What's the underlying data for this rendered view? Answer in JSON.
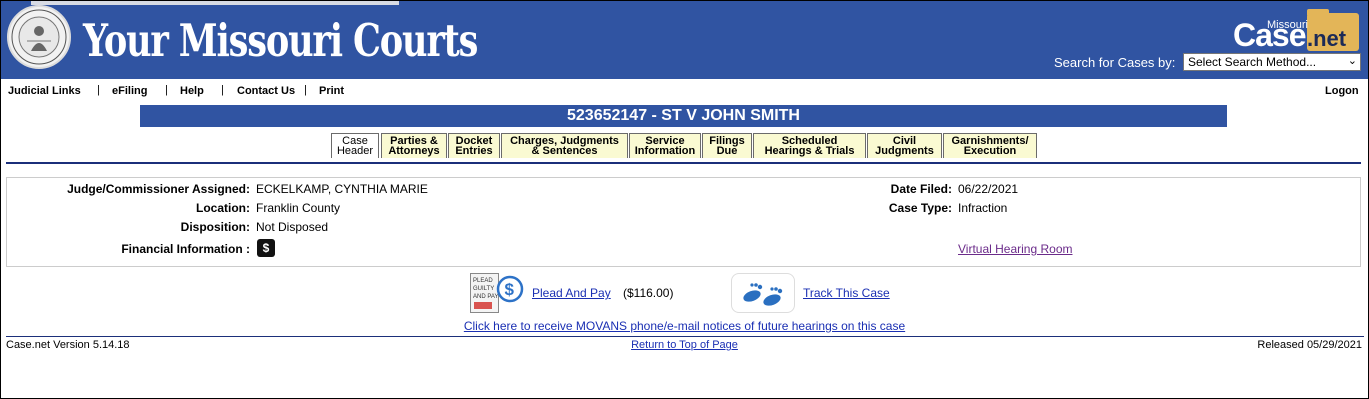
{
  "banner": {
    "title": "Your Missouri Courts",
    "logo_state": "Missouri",
    "logo_case": "Case",
    "logo_net": ".net",
    "search_label": "Search for Cases by:",
    "search_selected": "Select Search Method..."
  },
  "nav": {
    "items": [
      "Judicial Links",
      "eFiling",
      "Help",
      "Contact Us",
      "Print"
    ],
    "separator": "|",
    "logon": "Logon"
  },
  "case_caption": "523652147 - ST V JOHN SMITH",
  "tabs": [
    {
      "label": "Case\nHeader",
      "active": true
    },
    {
      "label": "Parties &\nAttorneys",
      "active": false
    },
    {
      "label": "Docket\nEntries",
      "active": false
    },
    {
      "label": "Charges, Judgments\n& Sentences",
      "active": false
    },
    {
      "label": "Service\nInformation",
      "active": false
    },
    {
      "label": "Filings\nDue",
      "active": false
    },
    {
      "label": "Scheduled\nHearings & Trials",
      "active": false
    },
    {
      "label": "Civil\nJudgments",
      "active": false
    },
    {
      "label": "Garnishments/\nExecution",
      "active": false
    }
  ],
  "details": {
    "judge_label": "Judge/Commissioner Assigned:",
    "judge_value": "ECKELKAMP, CYNTHIA MARIE",
    "location_label": "Location:",
    "location_value": "Franklin County",
    "disposition_label": "Disposition:",
    "disposition_value": "Not Disposed",
    "financial_label": "Financial Information :",
    "financial_icon": "$",
    "date_filed_label": "Date Filed:",
    "date_filed_value": "06/22/2021",
    "case_type_label": "Case Type:",
    "case_type_value": "Infraction",
    "virtual_hearing_link": "Virtual Hearing Room"
  },
  "actions": {
    "plead_link": "Plead And Pay",
    "plead_amount": "($116.00)",
    "plead_icon_text": [
      "PLEAD",
      "GUILTY",
      "AND PAY"
    ],
    "track_link": "Track This Case",
    "movans_link": "Click here to receive MOVANS phone/e-mail notices of future hearings on this case"
  },
  "footer": {
    "version": "Case.net Version 5.14.18",
    "top_link": "Return to Top of Page",
    "released": "Released 05/29/2021"
  },
  "colors": {
    "banner_blue": "#3054A2",
    "tab_yellow": "#fafad2",
    "link_blue": "#1a2fb3",
    "visited_purple": "#6b2b8a",
    "logo_gold": "#e3b558"
  }
}
